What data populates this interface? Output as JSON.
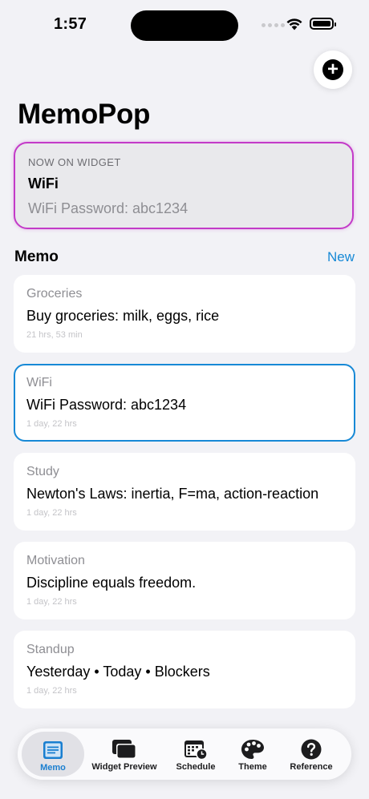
{
  "status_bar": {
    "time": "1:57"
  },
  "header": {
    "title": "MemoPop"
  },
  "widget": {
    "label": "NOW ON WIDGET",
    "title": "WiFi",
    "body": "WiFi Password: abc1234",
    "border_color": "#c33ac8"
  },
  "section": {
    "title": "Memo",
    "new_label": "New"
  },
  "memos": [
    {
      "title": "Groceries",
      "body": "Buy groceries: milk, eggs, rice",
      "time": "21 hrs, 53 min",
      "selected": false
    },
    {
      "title": "WiFi",
      "body": "WiFi Password: abc1234",
      "time": "1 day, 22 hrs",
      "selected": true
    },
    {
      "title": "Study",
      "body": "Newton's Laws: inertia, F=ma, action-reaction",
      "time": "1 day, 22 hrs",
      "selected": false
    },
    {
      "title": "Motivation",
      "body": "Discipline equals freedom.",
      "time": "1 day, 22 hrs",
      "selected": false
    },
    {
      "title": "Standup",
      "body": "Yesterday • Today • Blockers",
      "time": "1 day, 22 hrs",
      "selected": false
    }
  ],
  "tabs": [
    {
      "label": "Memo",
      "icon": "memo-icon",
      "active": true
    },
    {
      "label": "Widget Preview",
      "icon": "widget-preview-icon",
      "active": false
    },
    {
      "label": "Schedule",
      "icon": "schedule-icon",
      "active": false
    },
    {
      "label": "Theme",
      "icon": "palette-icon",
      "active": false
    },
    {
      "label": "Reference",
      "icon": "help-icon",
      "active": false
    }
  ],
  "colors": {
    "accent": "#1789d6",
    "background": "#f2f2f6"
  }
}
